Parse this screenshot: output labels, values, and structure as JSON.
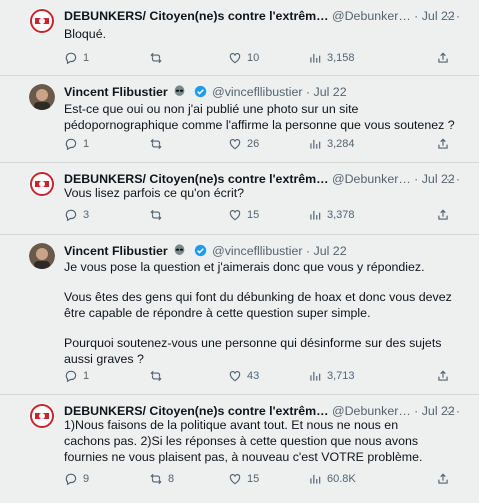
{
  "tweets": [
    {
      "author": "DEBUNKERS/ Citoyen(ne)s contre l'extrêm…",
      "handle": "@Debunker… · Jul 22",
      "avatar": "debunkers-logo",
      "text": [
        "Bloqué."
      ],
      "replies": "1",
      "retweets": "",
      "likes": "10",
      "views": "3,158"
    },
    {
      "author": "Vincent Flibustier",
      "handle": "@vincefllibustier · Jul 22",
      "avatar": "person-photo",
      "badges": [
        "alien-icon",
        "verified-icon"
      ],
      "text": [
        "Est-ce que oui ou non j'ai publié une photo sur un site pédopornographique comme l'affirme la personne que vous soutenez ?"
      ],
      "replies": "1",
      "retweets": "",
      "likes": "26",
      "views": "3,284"
    },
    {
      "author": "DEBUNKERS/ Citoyen(ne)s contre l'extrêm…",
      "handle": "@Debunker… · Jul 22",
      "avatar": "debunkers-logo",
      "text": [
        "Vous lisez parfois ce qu'on écrit?"
      ],
      "replies": "3",
      "retweets": "",
      "likes": "15",
      "views": "3,378"
    },
    {
      "author": "Vincent Flibustier",
      "handle": "@vincefllibustier · Jul 22",
      "avatar": "person-photo",
      "badges": [
        "alien-icon",
        "verified-icon"
      ],
      "text": [
        "Je vous pose la question et j'aimerais donc que vous y répondiez.",
        "Vous êtes des gens qui font du débunking de hoax et donc vous devez être capable de répondre à cette question super simple.",
        "Pourquoi soutenez-vous une personne qui désinforme sur des sujets aussi graves ?"
      ],
      "replies": "1",
      "retweets": "",
      "likes": "43",
      "views": "3,713"
    },
    {
      "author": "DEBUNKERS/ Citoyen(ne)s contre l'extrêm…",
      "handle": "@Debunker… · Jul 22",
      "avatar": "debunkers-logo",
      "text": [
        "1)Nous faisons de la politique avant tout. Et nous ne nous en cachons pas. 2)Si les réponses à cette question que nous avons fournies ne vous plaisent pas, à nouveau c'est VOTRE problème."
      ],
      "replies": "9",
      "retweets": "8",
      "likes": "15",
      "views": "60.8K"
    }
  ],
  "more_label": "···"
}
